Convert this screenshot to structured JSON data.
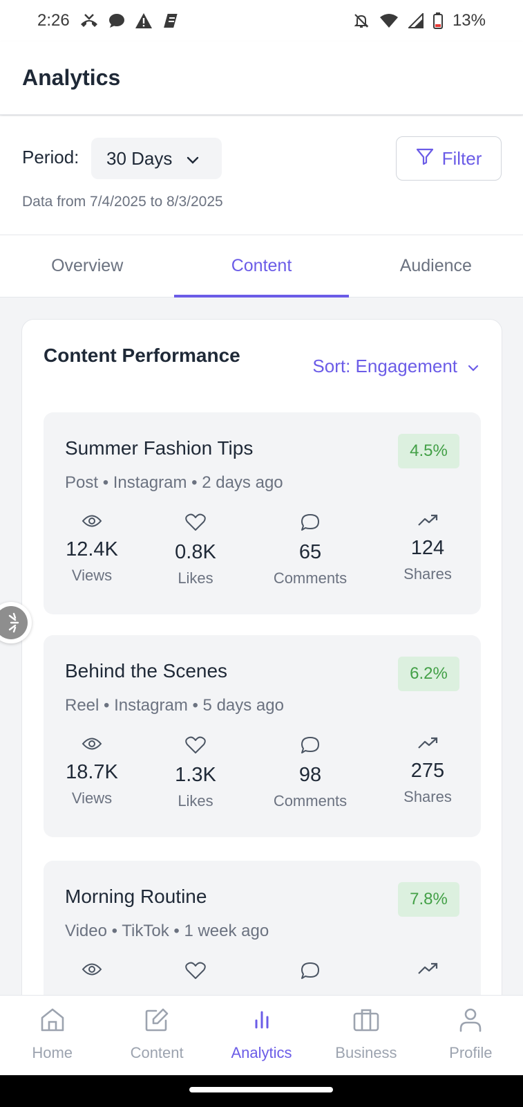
{
  "status": {
    "time": "2:26",
    "battery": "13%"
  },
  "header": {
    "title": "Analytics"
  },
  "period": {
    "label": "Period:",
    "value": "30 Days",
    "filter_label": "Filter",
    "range_text": "Data from 7/4/2025 to 8/3/2025"
  },
  "tabs": [
    {
      "label": "Overview"
    },
    {
      "label": "Content",
      "active": true
    },
    {
      "label": "Audience"
    }
  ],
  "content_card": {
    "title": "Content Performance",
    "sort_label": "Sort: Engagement",
    "items": [
      {
        "title": "Summer Fashion Tips",
        "meta": "Post • Instagram • 2 days ago",
        "engagement": "4.5%",
        "views": "12.4K",
        "likes": "0.8K",
        "comments": "65",
        "shares": "124"
      },
      {
        "title": "Behind the Scenes",
        "meta": "Reel • Instagram • 5 days ago",
        "engagement": "6.2%",
        "views": "18.7K",
        "likes": "1.3K",
        "comments": "98",
        "shares": "275"
      },
      {
        "title": "Morning Routine",
        "meta": "Video • TikTok • 1 week ago",
        "engagement": "7.8%"
      }
    ],
    "stat_labels": {
      "views": "Views",
      "likes": "Likes",
      "comments": "Comments",
      "shares": "Shares"
    }
  },
  "bottom_nav": [
    {
      "label": "Home",
      "icon": "home-icon"
    },
    {
      "label": "Content",
      "icon": "edit-icon"
    },
    {
      "label": "Analytics",
      "icon": "bar-chart-icon",
      "active": true
    },
    {
      "label": "Business",
      "icon": "briefcase-icon"
    },
    {
      "label": "Profile",
      "icon": "user-icon"
    }
  ],
  "colors": {
    "accent": "#6b5ce7",
    "badge_bg": "#dcf0df",
    "badge_text": "#43a047"
  }
}
